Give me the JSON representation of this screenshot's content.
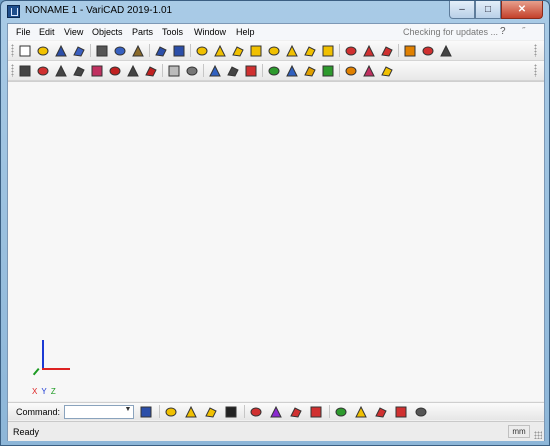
{
  "window": {
    "title": "NONAME 1 - VariCAD 2019-1.01",
    "controls": {
      "minimize": "–",
      "maximize": "□",
      "close": "✕"
    }
  },
  "menubar": {
    "items": [
      "File",
      "Edit",
      "View",
      "Objects",
      "Parts",
      "Tools",
      "Window",
      "Help"
    ],
    "update_status": "Checking for updates ...",
    "help_glyph": "?",
    "overflow_glyph": "˝"
  },
  "toolbar1": {
    "buttons": [
      {
        "name": "new-file-icon",
        "color": "#ffffff"
      },
      {
        "name": "open-folder-icon",
        "color": "#f2c200"
      },
      {
        "name": "save-icon",
        "color": "#2b4ea8"
      },
      {
        "name": "save-all-icon",
        "color": "#3b5fc0"
      },
      {
        "name": "print-icon",
        "color": "#555555"
      },
      {
        "name": "copy-icon",
        "color": "#3660c0"
      },
      {
        "name": "paste-icon",
        "color": "#8a6a2a"
      },
      {
        "name": "undo-icon",
        "color": "#2b4ea8"
      },
      {
        "name": "redo-icon",
        "color": "#2b4ea8"
      },
      {
        "name": "box-solid-icon",
        "color": "#f0c000"
      },
      {
        "name": "cylinder-solid-icon",
        "color": "#f0c000"
      },
      {
        "name": "cone-solid-icon",
        "color": "#f0c000"
      },
      {
        "name": "sphere-solid-icon",
        "color": "#f0c000"
      },
      {
        "name": "pipe-solid-icon",
        "color": "#f0c000"
      },
      {
        "name": "elbow-solid-icon",
        "color": "#f0c000"
      },
      {
        "name": "torus-solid-icon",
        "color": "#f0c000"
      },
      {
        "name": "bend-solid-icon",
        "color": "#f0c000"
      },
      {
        "name": "section-view-icon",
        "color": "#d03030"
      },
      {
        "name": "frame-view-icon",
        "color": "#d03030"
      },
      {
        "name": "layout-view-icon",
        "color": "#d03030"
      },
      {
        "name": "transform-icon",
        "color": "#e08000"
      },
      {
        "name": "calculate-icon",
        "color": "#d03030"
      },
      {
        "name": "zoom-icon",
        "color": "#444444"
      }
    ]
  },
  "toolbar2": {
    "buttons": [
      {
        "name": "select-icon",
        "color": "#444444"
      },
      {
        "name": "delete-icon",
        "color": "#d03030"
      },
      {
        "name": "move-icon",
        "color": "#444444"
      },
      {
        "name": "rotate-icon",
        "color": "#444444"
      },
      {
        "name": "mirror-icon",
        "color": "#c03060"
      },
      {
        "name": "copy-object-icon",
        "color": "#c02020"
      },
      {
        "name": "scale-icon",
        "color": "#444444"
      },
      {
        "name": "tools-icon",
        "color": "#c02020"
      },
      {
        "name": "wireframe-box-icon",
        "color": "#bbbbbb"
      },
      {
        "name": "hidden-line-icon",
        "color": "#777777"
      },
      {
        "name": "layers-icon",
        "color": "#3060c0"
      },
      {
        "name": "dimension-icon",
        "color": "#444444"
      },
      {
        "name": "hatch-icon",
        "color": "#d03030"
      },
      {
        "name": "color-icon",
        "color": "#2d9a2d"
      },
      {
        "name": "render-icon",
        "color": "#3060c0"
      },
      {
        "name": "lighting-icon",
        "color": "#e0a000"
      },
      {
        "name": "shading-icon",
        "color": "#2d9a2d"
      },
      {
        "name": "home-view-icon",
        "color": "#e08000"
      },
      {
        "name": "measure-icon",
        "color": "#c03060"
      },
      {
        "name": "properties-icon",
        "color": "#f0c000"
      }
    ]
  },
  "canvas": {
    "axes": {
      "x_label": "X",
      "y_label": "Y",
      "z_label": "Z"
    }
  },
  "commandbar": {
    "label": "Command:",
    "input_value": "",
    "buttons": [
      {
        "name": "execute-icon",
        "color": "#2b4ea8"
      },
      {
        "name": "solid-box-icon",
        "color": "#f0c000"
      },
      {
        "name": "solid-elbow-icon",
        "color": "#f0c000"
      },
      {
        "name": "solid-profile-icon",
        "color": "#f0c000"
      },
      {
        "name": "text-tool-icon",
        "color": "#222222"
      },
      {
        "name": "attach-icon",
        "color": "#d03030"
      },
      {
        "name": "connector-icon",
        "color": "#8a2ad0"
      },
      {
        "name": "paint-icon",
        "color": "#d03030"
      },
      {
        "name": "hole-icon",
        "color": "#d03030"
      },
      {
        "name": "group-icon",
        "color": "#2d9a2d"
      },
      {
        "name": "assembly-icon",
        "color": "#f0c000"
      },
      {
        "name": "bom-icon",
        "color": "#d03030"
      },
      {
        "name": "export-icon",
        "color": "#d03030"
      },
      {
        "name": "settings-icon",
        "color": "#555555"
      }
    ]
  },
  "statusbar": {
    "status": "Ready",
    "unit": "mm"
  }
}
